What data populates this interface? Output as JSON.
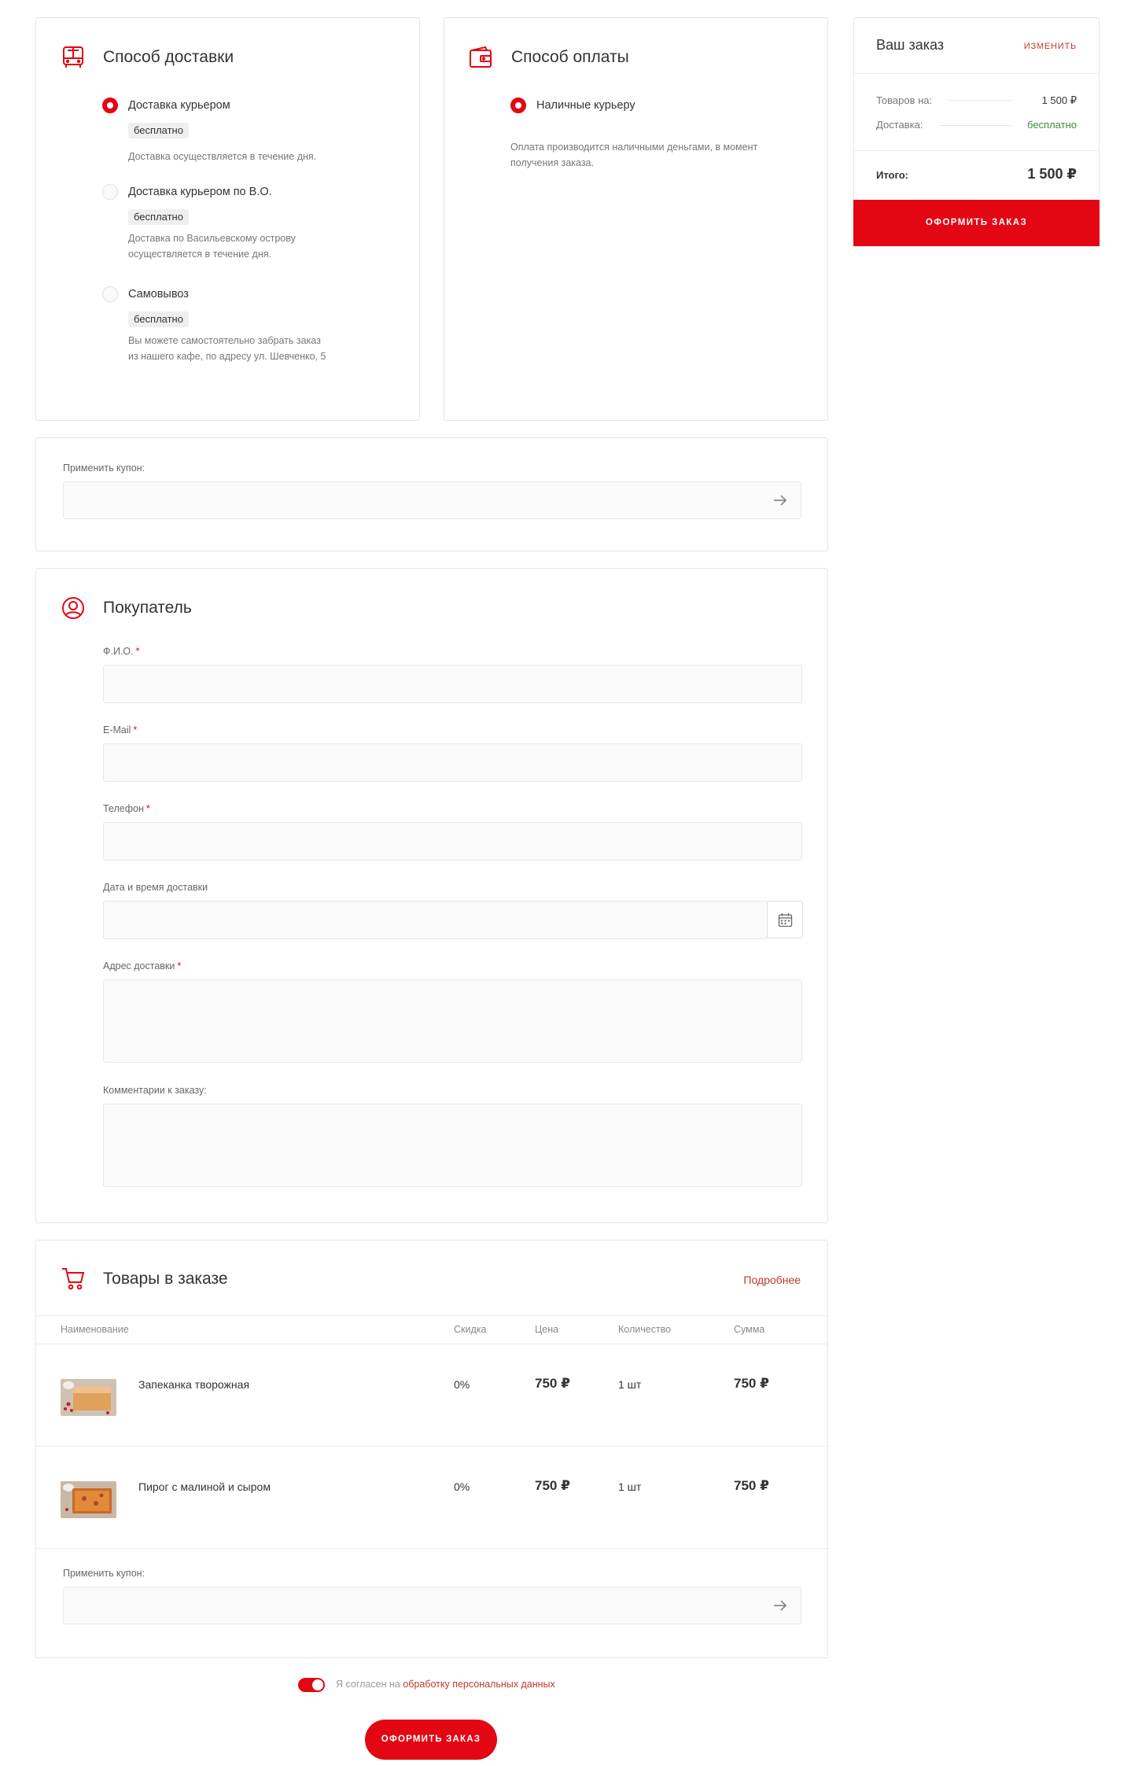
{
  "delivery": {
    "title": "Способ доставки",
    "options": [
      {
        "label": "Доставка курьером",
        "badge": "бесплатно",
        "desc": "Доставка осуществляется в течение дня.",
        "selected": true
      },
      {
        "label": "Доставка курьером по В.О.",
        "badge": "бесплатно",
        "desc_lines": [
          "Доставка по Васильевскому острову",
          "осуществляется в течение дня."
        ],
        "selected": false
      },
      {
        "label": "Самовывоз",
        "badge": "бесплатно",
        "desc_lines": [
          "Вы можете самостоятельно забрать заказ",
          "из нашего кафе, по адресу ул. Шевченко, 5"
        ],
        "selected": false
      }
    ]
  },
  "payment": {
    "title": "Способ оплаты",
    "option": "Наличные курьеру",
    "desc_lines": [
      "Оплата производится наличными деньгами, в момент",
      "получения заказа."
    ]
  },
  "coupon": {
    "label": "Применить купон:",
    "value": ""
  },
  "buyer": {
    "title": "Покупатель",
    "fields": [
      {
        "label": "Ф.И.О.",
        "required": true
      },
      {
        "label": "E-Mail",
        "required": true
      },
      {
        "label": "Телефон",
        "required": true
      },
      {
        "label": "Дата и время доставки",
        "required": false
      },
      {
        "label": "Адрес доставки",
        "required": true
      },
      {
        "label": "Комментарии к заказу:",
        "required": false
      }
    ],
    "required_mark": "*"
  },
  "items": {
    "title": "Товары в заказе",
    "more_link": "Подробнее",
    "headers": [
      "Наименование",
      "Скидка",
      "Цена",
      "Количество",
      "Сумма"
    ],
    "rows": [
      {
        "name": "Запеканка творожная",
        "discount": "0%",
        "price": "750 ₽",
        "qty": "1 шт",
        "sum": "750 ₽"
      },
      {
        "name": "Пирог с малиной и сыром",
        "discount": "0%",
        "price": "750 ₽",
        "qty": "1 шт",
        "sum": "750 ₽"
      }
    ]
  },
  "summary": {
    "title": "Ваш заказ",
    "edit": "ИЗМЕНИТЬ",
    "goods_label": "Товаров на:",
    "goods_value": "1 500 ₽",
    "delivery_label": "Доставка:",
    "delivery_value": "бесплатно",
    "total_label": "Итого:",
    "total_value": "1 500 ₽",
    "button": "ОФОРМИТЬ ЗАКАЗ"
  },
  "consent": {
    "text": "Я согласен на",
    "link": "обработку персональных данных",
    "checked": true
  },
  "submit": "ОФОРМИТЬ ЗАКАЗ",
  "colors": {
    "accent": "#e30613",
    "free": "#3a8a3a"
  }
}
